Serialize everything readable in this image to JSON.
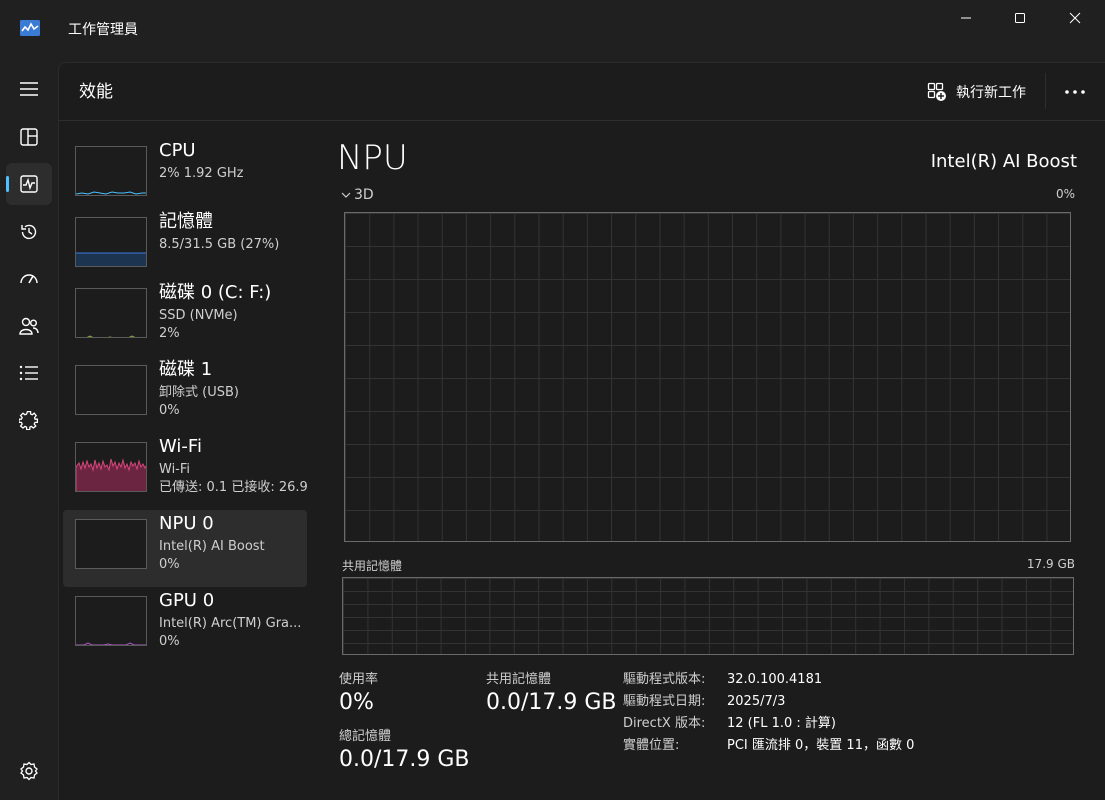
{
  "window": {
    "title": "工作管理員",
    "minimize_icon": "minimize-icon",
    "maximize_icon": "maximize-icon",
    "close_icon": "close-icon"
  },
  "nav": {
    "items": [
      {
        "name": "hamburger-menu",
        "icon": "hamburger-icon"
      },
      {
        "name": "processes",
        "icon": "processes-icon"
      },
      {
        "name": "performance",
        "icon": "performance-icon",
        "active": true
      },
      {
        "name": "app-history",
        "icon": "history-icon"
      },
      {
        "name": "startup-apps",
        "icon": "startup-icon"
      },
      {
        "name": "users",
        "icon": "users-icon"
      },
      {
        "name": "details",
        "icon": "list-icon"
      },
      {
        "name": "services",
        "icon": "services-icon"
      },
      {
        "name": "settings",
        "icon": "gear-icon"
      }
    ],
    "accent": "#4cc2ff"
  },
  "header": {
    "title": "效能",
    "run_task_label": "執行新工作"
  },
  "devices": [
    {
      "name": "CPU",
      "sub1": "2%  1.92 GHz",
      "sub2": "",
      "color": "#4cc2ff"
    },
    {
      "name": "記憶體",
      "sub1": "8.5/31.5 GB (27%)",
      "sub2": "",
      "color": "#3b7de0"
    },
    {
      "name": "磁碟 0 (C: F:)",
      "sub1": "SSD (NVMe)",
      "sub2": "2%",
      "color": "#8ab43c"
    },
    {
      "name": "磁碟 1",
      "sub1": "卸除式 (USB)",
      "sub2": "0%",
      "color": "#8ab43c"
    },
    {
      "name": "Wi-Fi",
      "sub1": "Wi-Fi",
      "sub2": "已傳送: 0.1 已接收: 26.9",
      "color": "#d6477b"
    },
    {
      "name": "NPU 0",
      "sub1": "Intel(R) AI Boost",
      "sub2": "0%",
      "color": "#4cc2ff",
      "selected": true
    },
    {
      "name": "GPU 0",
      "sub1": "Intel(R) Arc(TM) Gra...",
      "sub2": "0%",
      "color": "#b05cc8"
    }
  ],
  "detail": {
    "title": "NPU",
    "model": "Intel(R) AI Boost",
    "engine_label": "3D",
    "engine_pct": "0%",
    "shared_mem_label": "共用記憶體",
    "shared_mem_total": "17.9 GB",
    "stats": {
      "utilization_label": "使用率",
      "utilization_value": "0%",
      "shared_mem_label": "共用記憶體",
      "shared_mem_value": "0.0/17.9 GB",
      "total_mem_label": "總記憶體",
      "total_mem_value": "0.0/17.9 GB"
    },
    "info": [
      {
        "key": "驅動程式版本:",
        "value": "32.0.100.4181"
      },
      {
        "key": "驅動程式日期:",
        "value": "2025/7/3"
      },
      {
        "key": "DirectX 版本:",
        "value": "12 (FL 1.0 : 計算)"
      },
      {
        "key": "實體位置:",
        "value": "PCI 匯流排 0，裝置 11，函數 0"
      }
    ]
  }
}
